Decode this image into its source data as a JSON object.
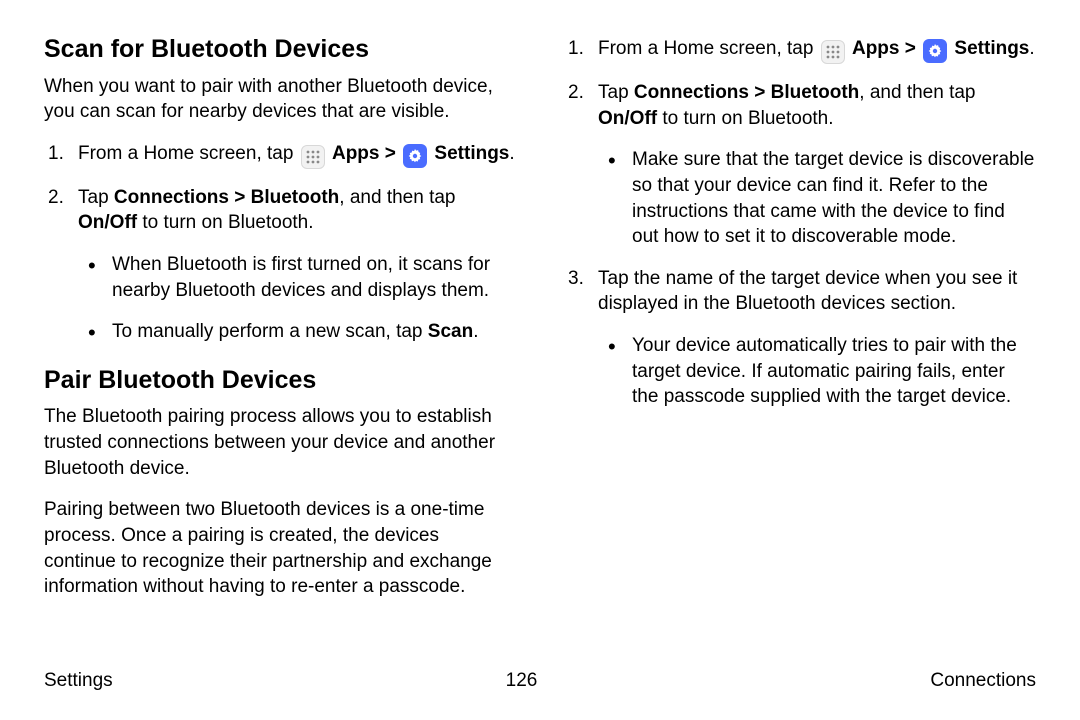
{
  "left": {
    "h1": "Scan for Bluetooth Devices",
    "p1": "When you want to pair with another Bluetooth device, you can scan for nearby devices that are visible.",
    "s1_pre": "From a Home screen, tap ",
    "apps": "Apps",
    "gt": " > ",
    "settings": "Settings",
    "dot": ".",
    "s2_pre": "Tap ",
    "s2_b1": "Connections > Bluetooth",
    "s2_mid": ", and then tap ",
    "s2_b2": "On/Off",
    "s2_post": " to turn on Bluetooth.",
    "s2_sub1": "When Bluetooth is first turned on, it scans for nearby Bluetooth devices and displays them.",
    "s2_sub2_pre": "To manually perform a new scan, tap ",
    "s2_sub2_b": "Scan",
    "h2": "Pair Bluetooth Devices",
    "p2": "The Bluetooth pairing process allows you to establish trusted connections between your device and another Bluetooth device.",
    "p3": "Pairing between two Bluetooth devices is a one-time process. Once a pairing is created, the devices continue to recognize their partnership and exchange information without having to re-enter a passcode."
  },
  "right": {
    "s1_pre": "From a Home screen, tap ",
    "apps": "Apps",
    "gt": " > ",
    "settings": "Settings",
    "dot": ".",
    "s2_pre": "Tap ",
    "s2_b1": "Connections > Bluetooth",
    "s2_mid": ", and then tap ",
    "s2_b2": "On/Off",
    "s2_post": " to turn on Bluetooth.",
    "s2_sub1": "Make sure that the target device is discoverable so that your device can find it. Refer to the instructions that came with the device to find out how to set it to discoverable mode.",
    "s3": "Tap the name of the target device when you see it displayed in the Bluetooth devices section.",
    "s3_sub1": "Your device automatically tries to pair with the target device. If automatic pairing fails, enter the passcode supplied with the target device."
  },
  "footer": {
    "left": "Settings",
    "center": "126",
    "right": "Connections"
  }
}
